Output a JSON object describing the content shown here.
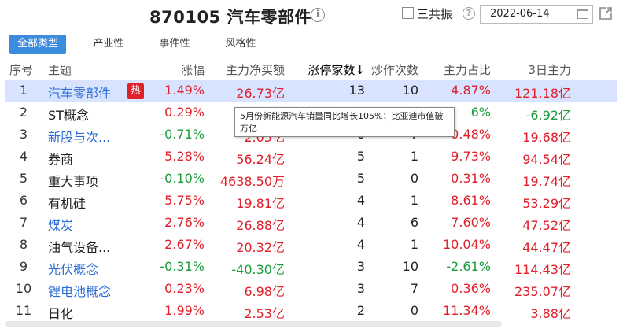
{
  "header": {
    "title": "870105 汽车零部件",
    "checkbox_label": "三共振",
    "date": "2022-06-14"
  },
  "tabs": [
    {
      "label": "全部类型",
      "active": true
    },
    {
      "label": "产业性",
      "active": false
    },
    {
      "label": "事件性",
      "active": false
    },
    {
      "label": "风格性",
      "active": false
    }
  ],
  "columns": {
    "idx": "序号",
    "name": "主题",
    "chg": "涨幅",
    "net": "主力净买额",
    "limit": "涨停家数↓",
    "spec": "炒作次数",
    "ratio": "主力占比",
    "three": "3日主力"
  },
  "rows": [
    {
      "idx": "1",
      "name": "汽车零部件",
      "link": true,
      "hot": "热",
      "chg": "1.49%",
      "net": "26.73亿",
      "limit": "13",
      "spec": "10",
      "ratio": "4.87%",
      "three": "121.18亿",
      "chg_c": "red",
      "net_c": "red",
      "ratio_c": "red",
      "three_c": "red"
    },
    {
      "idx": "2",
      "name": "ST概念",
      "link": false,
      "chg": "0.29%",
      "net": "",
      "limit": "",
      "spec": "",
      "ratio": "6%",
      "three": "-6.92亿",
      "chg_c": "red",
      "net_c": "red",
      "ratio_c": "green",
      "three_c": "green"
    },
    {
      "idx": "3",
      "name": "新股与次...",
      "link": true,
      "chg": "-0.71%",
      "net": "2.05亿",
      "limit": "0",
      "spec": "7",
      "ratio": "0.48%",
      "three": "19.68亿",
      "chg_c": "green",
      "net_c": "red",
      "ratio_c": "red",
      "three_c": "red"
    },
    {
      "idx": "4",
      "name": "券商",
      "link": false,
      "chg": "5.28%",
      "net": "56.24亿",
      "limit": "5",
      "spec": "1",
      "ratio": "9.73%",
      "three": "94.54亿",
      "chg_c": "red",
      "net_c": "red",
      "ratio_c": "red",
      "three_c": "red"
    },
    {
      "idx": "5",
      "name": "重大事项",
      "link": false,
      "chg": "-0.10%",
      "net": "4638.50万",
      "limit": "5",
      "spec": "0",
      "ratio": "0.31%",
      "three": "19.74亿",
      "chg_c": "green",
      "net_c": "red",
      "ratio_c": "red",
      "three_c": "red"
    },
    {
      "idx": "6",
      "name": "有机硅",
      "link": false,
      "chg": "5.75%",
      "net": "19.81亿",
      "limit": "4",
      "spec": "1",
      "ratio": "8.61%",
      "three": "53.29亿",
      "chg_c": "red",
      "net_c": "red",
      "ratio_c": "red",
      "three_c": "red"
    },
    {
      "idx": "7",
      "name": "煤炭",
      "link": true,
      "chg": "2.76%",
      "net": "26.88亿",
      "limit": "4",
      "spec": "6",
      "ratio": "7.60%",
      "three": "47.52亿",
      "chg_c": "red",
      "net_c": "red",
      "ratio_c": "red",
      "three_c": "red"
    },
    {
      "idx": "8",
      "name": "油气设备...",
      "link": false,
      "chg": "2.67%",
      "net": "20.32亿",
      "limit": "4",
      "spec": "1",
      "ratio": "10.04%",
      "three": "44.47亿",
      "chg_c": "red",
      "net_c": "red",
      "ratio_c": "red",
      "three_c": "red"
    },
    {
      "idx": "9",
      "name": "光伏概念",
      "link": true,
      "chg": "-0.31%",
      "net": "-40.30亿",
      "limit": "3",
      "spec": "10",
      "ratio": "-2.61%",
      "three": "114.43亿",
      "chg_c": "green",
      "net_c": "green",
      "ratio_c": "green",
      "three_c": "red"
    },
    {
      "idx": "10",
      "name": "锂电池概念",
      "link": true,
      "chg": "0.23%",
      "net": "6.98亿",
      "limit": "3",
      "spec": "7",
      "ratio": "0.36%",
      "three": "235.07亿",
      "chg_c": "red",
      "net_c": "red",
      "ratio_c": "red",
      "three_c": "red"
    },
    {
      "idx": "11",
      "name": "日化",
      "link": false,
      "chg": "1.99%",
      "net": "2.53亿",
      "limit": "2",
      "spec": "0",
      "ratio": "11.34%",
      "three": "3.88亿",
      "chg_c": "red",
      "net_c": "red",
      "ratio_c": "red",
      "three_c": "red"
    }
  ],
  "tooltip": "5月份新能源汽车销量同比增长105%；比亚迪市值破万亿",
  "colors": {
    "up": "#e0202b",
    "down": "#1a9c3c",
    "accent": "#3b8bde",
    "selected": "#d8e4ff"
  }
}
